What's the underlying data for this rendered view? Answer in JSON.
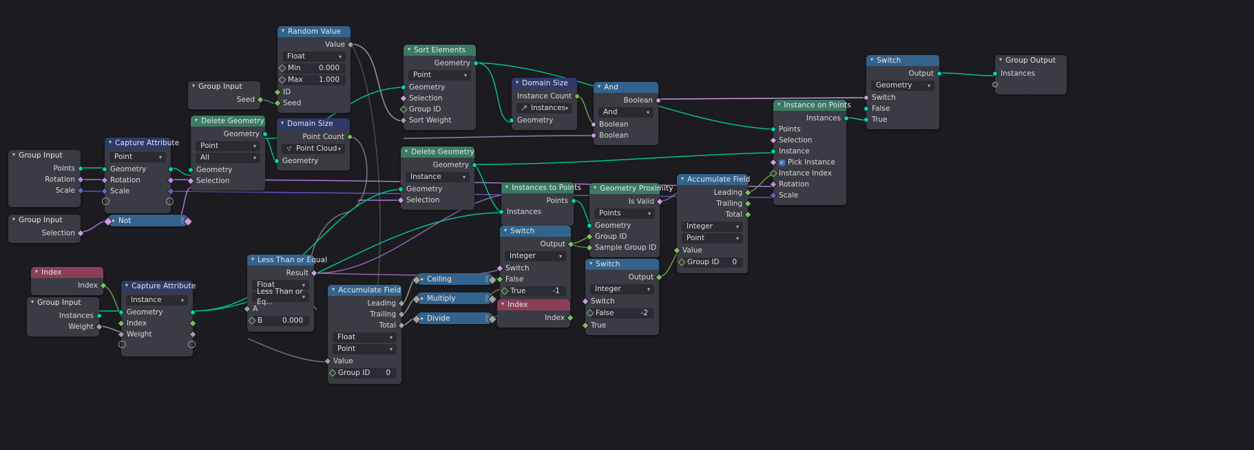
{
  "app": {
    "editor": "Blender Geometry Node Editor",
    "canvas_bg": "#1b1b20"
  },
  "colors": {
    "header_geometry": "#3b7a63",
    "header_converter": "#33638c",
    "header_attribute": "#2d3a6b",
    "header_input": "#3a3a42",
    "header_index": "#8b3f57",
    "socket_geometry": "#00d6a3",
    "socket_boolean": "#cc9ee0",
    "socket_integer": "#79c05a",
    "socket_float": "#a1a1a1",
    "socket_vector": "#6363c7",
    "socket_rotation": "#c088e0"
  },
  "nodes": {
    "random_value": {
      "title": "Random Value",
      "out_value": "Value",
      "type_dropdown": "Float",
      "min_label": "Min",
      "min_value": "0.000",
      "max_label": "Max",
      "max_value": "1.000",
      "in_id": "ID",
      "in_seed": "Seed"
    },
    "sort_elements": {
      "title": "Sort Elements",
      "out_geometry": "Geometry",
      "domain_dropdown": "Point",
      "in_geometry": "Geometry",
      "in_selection": "Selection",
      "in_group_id": "Group ID",
      "in_sort_weight": "Sort Weight"
    },
    "group_input_seed": {
      "title": "Group Input",
      "out_seed": "Seed"
    },
    "domain_size_top": {
      "title": "Domain Size",
      "out_instance_count": "Instance Count",
      "component_dropdown": "Instances",
      "in_geometry": "Geometry"
    },
    "and_node": {
      "title": "And",
      "out_boolean": "Boolean",
      "operation_dropdown": "And",
      "in_boolean_1": "Boolean",
      "in_boolean_2": "Boolean"
    },
    "instance_on_points": {
      "title": "Instance on Points",
      "out_instances": "Instances",
      "in_points": "Points",
      "in_selection": "Selection",
      "in_instance": "Instance",
      "in_pick_instance": "Pick Instance",
      "pick_instance_checked": true,
      "in_instance_index": "Instance Index",
      "in_rotation": "Rotation",
      "in_scale": "Scale"
    },
    "switch_right": {
      "title": "Switch",
      "out_output": "Output",
      "type_dropdown": "Geometry",
      "in_switch": "Switch",
      "in_false": "False",
      "in_true": "True"
    },
    "group_output": {
      "title": "Group Output",
      "in_instances": "Instances"
    },
    "group_input_left": {
      "title": "Group Input",
      "out_points": "Points",
      "out_rotation": "Rotation",
      "out_scale": "Scale"
    },
    "capture_attribute_top": {
      "title": "Capture Attribute",
      "domain_dropdown": "Point",
      "in_geometry": "Geometry",
      "in_rotation": "Rotation",
      "in_scale": "Scale"
    },
    "delete_geometry_top": {
      "title": "Delete Geometry",
      "out_geometry": "Geometry",
      "domain_dropdown": "Point",
      "mode_dropdown": "All",
      "in_geometry": "Geometry",
      "in_selection": "Selection"
    },
    "domain_size_mid": {
      "title": "Domain Size",
      "out_point_count": "Point Count",
      "component_dropdown": "Point Cloud",
      "in_geometry": "Geometry"
    },
    "delete_geometry_mid": {
      "title": "Delete Geometry",
      "out_geometry": "Geometry",
      "domain_dropdown": "Instance",
      "in_geometry": "Geometry",
      "in_selection": "Selection"
    },
    "group_input_selection": {
      "title": "Group Input",
      "out_selection": "Selection"
    },
    "not_node": {
      "title": "Not"
    },
    "index_top": {
      "title": "Index",
      "out_index": "Index"
    },
    "group_input_instances": {
      "title": "Group Input",
      "out_instances": "Instances",
      "out_weight": "Weight"
    },
    "capture_attribute_bottom": {
      "title": "Capture Attribute",
      "domain_dropdown": "Instance",
      "in_geometry": "Geometry",
      "in_index": "Index",
      "in_weight": "Weight"
    },
    "less_than_or_equal": {
      "title": "Less Than or Equal",
      "out_result": "Result",
      "type_dropdown": "Float",
      "operation_dropdown": "Less Than or Eq...",
      "in_a": "A",
      "in_b_label": "B",
      "in_b_value": "0.000"
    },
    "accumulate_field_bottom": {
      "title": "Accumulate Field",
      "out_leading": "Leading",
      "out_trailing": "Trailing",
      "out_total": "Total",
      "type_dropdown": "Float",
      "domain_dropdown": "Point",
      "in_value": "Value",
      "in_group_id_label": "Group ID",
      "in_group_id_value": "0"
    },
    "ceiling": {
      "title": "Ceiling"
    },
    "multiply": {
      "title": "Multiply"
    },
    "divide": {
      "title": "Divide"
    },
    "instances_to_points": {
      "title": "Instances to Points",
      "out_points": "Points",
      "in_instances": "Instances"
    },
    "switch_mid": {
      "title": "Switch",
      "out_output": "Output",
      "type_dropdown": "Integer",
      "in_switch": "Switch",
      "in_false": "False",
      "in_true_label": "True",
      "in_true_value": "-1"
    },
    "index_bottom": {
      "title": "Index",
      "out_index": "Index"
    },
    "geometry_proximity": {
      "title": "Geometry Proximity",
      "out_is_valid": "Is Valid",
      "target_dropdown": "Points",
      "in_geometry": "Geometry",
      "in_group_id": "Group ID",
      "in_sample_group_id": "Sample Group ID"
    },
    "switch_bottom": {
      "title": "Switch",
      "out_output": "Output",
      "type_dropdown": "Integer",
      "in_switch": "Switch",
      "in_false_label": "False",
      "in_false_value": "-2",
      "in_true": "True"
    },
    "accumulate_field_right": {
      "title": "Accumulate Field",
      "out_leading": "Leading",
      "out_trailing": "Trailing",
      "out_total": "Total",
      "type_dropdown": "Integer",
      "domain_dropdown": "Point",
      "in_value": "Value",
      "in_group_id_label": "Group ID",
      "in_group_id_value": "0"
    }
  }
}
